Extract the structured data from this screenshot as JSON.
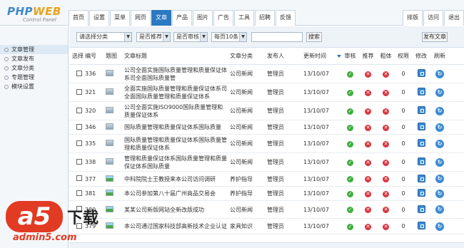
{
  "logo": {
    "main_a": "PHP",
    "main_b": "WEB",
    "sub": "Control Panel"
  },
  "nav": {
    "tabs": [
      "首页",
      "设置",
      "菜单",
      "网页",
      "文章",
      "产品",
      "图片",
      "广告",
      "工具",
      "招聘",
      "反馈"
    ],
    "active_index": 4,
    "right": [
      "排版",
      "访问",
      "退出"
    ]
  },
  "sidebar": {
    "items": [
      "文章管理",
      "文章发布",
      "文章分类",
      "专题管理",
      "模块设置"
    ],
    "active_index": 0
  },
  "filter": {
    "category": "请选择分类",
    "recommend": "是否推荐",
    "audit": "是否审核",
    "per_page": "每页10条",
    "search_value": "",
    "search_button": "搜索",
    "publish_button": "发布文章"
  },
  "table": {
    "headers": [
      "选择",
      "编号",
      "题图",
      "文章标题",
      "文章分类",
      "发布人",
      "更新时间",
      "审核",
      "推荐",
      "粗体",
      "权限",
      "修改",
      "刷新"
    ],
    "rows": [
      {
        "id": "336",
        "img": "gray",
        "title": "公司全面实施国际质量管理和质量保证体系司全面国际质量管",
        "cat": "公司新闻",
        "pub": "管理员",
        "time": "13/10/07",
        "audit": true,
        "rec": false,
        "bold": false,
        "perm": "0"
      },
      {
        "id": "321",
        "img": "gray",
        "title": "全面实施国际质量管理和质量保证体系司全面国际质量管理和质量保证体系",
        "cat": "公司新闻",
        "pub": "管理员",
        "time": "13/10/07",
        "audit": true,
        "rec": false,
        "bold": false,
        "perm": "0"
      },
      {
        "id": "320",
        "img": "gray",
        "title": "公司全面实施ISO9000国际质量管理和质量保证体系",
        "cat": "公司新闻",
        "pub": "管理员",
        "time": "13/10/07",
        "audit": true,
        "rec": false,
        "bold": false,
        "perm": "0"
      },
      {
        "id": "346",
        "img": "gray",
        "title": "国际质量管理和质量保证体系国际质量",
        "cat": "公司新闻",
        "pub": "管理员",
        "time": "13/10/07",
        "audit": true,
        "rec": false,
        "bold": false,
        "perm": "0"
      },
      {
        "id": "335",
        "img": "gray",
        "title": "国际质量管理和质量保证体系国际质量管理和质量保证体系",
        "cat": "公司新闻",
        "pub": "管理员",
        "time": "13/10/07",
        "audit": true,
        "rec": false,
        "bold": false,
        "perm": "0"
      },
      {
        "id": "338",
        "img": "gray",
        "title": "管理和质量保证体系国际质量管理和质量保证体系国际质量",
        "cat": "公司新闻",
        "pub": "管理员",
        "time": "13/10/07",
        "audit": true,
        "rec": false,
        "bold": false,
        "perm": "0"
      },
      {
        "id": "377",
        "img": "green",
        "title": "中科院院士王教授来本公司访问调研",
        "cat": "养护指导",
        "pub": "管理员",
        "time": "13/10/07",
        "audit": true,
        "rec": false,
        "bold": false,
        "perm": "0"
      },
      {
        "id": "381",
        "img": "green",
        "title": "本公司参加第八十届广州商品交易会",
        "cat": "养护指导",
        "pub": "管理员",
        "time": "13/10/07",
        "audit": true,
        "rec": false,
        "bold": false,
        "perm": "0"
      },
      {
        "id": "380",
        "img": "green",
        "title": "某某公司新版网站全新改版成功",
        "cat": "公司新闻",
        "pub": "管理员",
        "time": "13/10/07",
        "audit": true,
        "rec": false,
        "bold": false,
        "perm": "0"
      },
      {
        "id": "379",
        "img": "green",
        "title": "本公司通过国家科技部高新技术企业认证",
        "cat": "家具知识",
        "pub": "管理员",
        "time": "13/10/07",
        "audit": true,
        "rec": false,
        "bold": false,
        "perm": "0"
      }
    ]
  },
  "watermark": {
    "a5": "a5",
    "xiazai": "下载",
    "url": "admin5.com"
  },
  "colors": {
    "accent": "#2b79c2",
    "ok": "#3fae3f",
    "no": "#d9363e"
  }
}
